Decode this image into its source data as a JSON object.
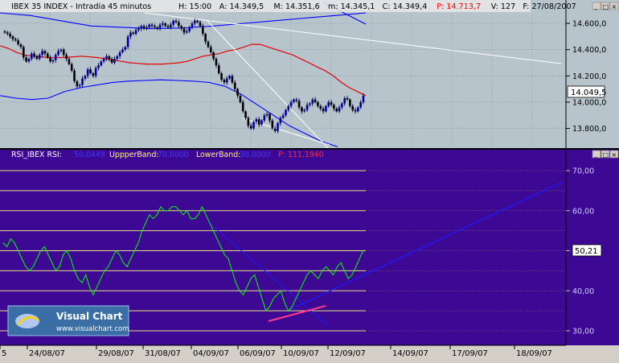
{
  "price_panel": {
    "title": "IBEX 35 INDEX - Intradia 45 minutos",
    "fields": [
      {
        "label": "H:",
        "value": "15:00",
        "color": "#000000"
      },
      {
        "label": "A:",
        "value": "14.349,5",
        "color": "#000000"
      },
      {
        "label": "M:",
        "value": "14.351,6",
        "color": "#000000"
      },
      {
        "label": "m:",
        "value": "14.345,1",
        "color": "#000000"
      },
      {
        "label": "C:",
        "value": "14.349,4",
        "color": "#000000"
      },
      {
        "label": "P:",
        "value": "14.713,7",
        "color": "#ff0000"
      },
      {
        "label": "V:",
        "value": "127",
        "color": "#000000"
      },
      {
        "label": "F:",
        "value": "27/08/2007",
        "color": "#000000"
      }
    ],
    "last_value_label": "14.049,5",
    "colors": {
      "background": "#b8c4cc",
      "candles": "#000080",
      "bollinger_band": "#0000ff",
      "moving_average": "#ff0000",
      "trendline": "#ffffff"
    }
  },
  "rsi_panel": {
    "title": "RSI_IBEX RSI:",
    "rsi_value": "50,0449",
    "upper_label": "UppperBand:",
    "upper_value": "70,0000",
    "lower_label": "LowerBand:",
    "lower_value": "30,0000",
    "p_label": "P:",
    "p_value": "111,1940",
    "last_value_label": "50,21",
    "colors": {
      "background": "#3c0894",
      "rsi_line": "#00ff00",
      "level_lines": "#e8e080",
      "trendline": "#1c1cff",
      "support_line": "#ff3c8c"
    }
  },
  "watermark": {
    "brand": "Visual Chart",
    "url": "www.visualchart.com"
  },
  "window_buttons": [
    "_",
    "□",
    "×"
  ],
  "chart_data": [
    {
      "type": "candlestick",
      "title": "IBEX 35 INDEX - Intradia 45 minutos",
      "y_ticks": [
        "13.800,0",
        "14.000,0",
        "14.200,0",
        "14.400,0",
        "14.600,0"
      ],
      "ylim": [
        13650,
        14680
      ],
      "close": [
        14530,
        14520,
        14500,
        14480,
        14470,
        14440,
        14420,
        14340,
        14310,
        14330,
        14370,
        14350,
        14330,
        14360,
        14390,
        14370,
        14340,
        14310,
        14320,
        14360,
        14390,
        14400,
        14360,
        14330,
        14290,
        14240,
        14160,
        14120,
        14130,
        14180,
        14200,
        14250,
        14220,
        14200,
        14260,
        14280,
        14310,
        14330,
        14350,
        14330,
        14300,
        14330,
        14350,
        14380,
        14400,
        14420,
        14500,
        14530,
        14520,
        14550,
        14560,
        14580,
        14560,
        14570,
        14590,
        14580,
        14570,
        14560,
        14590,
        14600,
        14580,
        14570,
        14590,
        14620,
        14610,
        14580,
        14560,
        14530,
        14540,
        14570,
        14600,
        14620,
        14610,
        14580,
        14520,
        14460,
        14420,
        14380,
        14330,
        14280,
        14220,
        14170,
        14150,
        14180,
        14200,
        14150,
        14100,
        14050,
        14000,
        13930,
        13880,
        13820,
        13800,
        13850,
        13870,
        13830,
        13860,
        13900,
        13910,
        13860,
        13800,
        13780,
        13840,
        13880,
        13900,
        13940,
        13970,
        14000,
        14020,
        14010,
        13960,
        13930,
        13940,
        13980,
        13990,
        14020,
        14000,
        13970,
        13950,
        13930,
        13970,
        14000,
        13980,
        13950,
        13930,
        13960,
        13990,
        14030,
        14020,
        13970,
        13940,
        13930,
        13960,
        14000,
        14049.5
      ],
      "series": [
        {
          "name": "Moving average (red)",
          "values": [
            14430,
            14410,
            14380,
            14360,
            14350,
            14345,
            14340,
            14340,
            14340,
            14345,
            14350,
            14345,
            14340,
            14330,
            14320,
            14310,
            14300,
            14295,
            14290,
            14290,
            14290,
            14295,
            14300,
            14310,
            14330,
            14350,
            14360,
            14370,
            14390,
            14400,
            14420,
            14440,
            14440,
            14420,
            14400,
            14380,
            14360,
            14330,
            14300,
            14270,
            14240,
            14200,
            14150,
            14110,
            14080,
            14049.5
          ]
        },
        {
          "name": "Upper band (blue)",
          "values": [
            14680,
            14660,
            14620,
            14580,
            14570,
            14560,
            14565,
            14580,
            14600,
            14620,
            14640,
            14660,
            14680
          ]
        },
        {
          "name": "Lower band (blue)",
          "values": [
            14050,
            14030,
            14020,
            14030,
            14080,
            14110,
            14130,
            14150,
            14160,
            14165,
            14170,
            14165,
            14160,
            14150,
            14120,
            14060,
            13980,
            13900,
            13820,
            13760,
            13700,
            13660
          ]
        }
      ]
    },
    {
      "type": "line",
      "title": "RSI_IBEX RSI:",
      "y_ticks": [
        "30,00",
        "40,00",
        "50,00",
        "60,00",
        "70,00"
      ],
      "ylim": [
        25,
        75
      ],
      "levels": [
        30,
        35,
        40,
        45,
        50,
        55,
        60,
        65,
        70
      ],
      "x_labels": [
        "5",
        "24/08/07",
        "29/08/07",
        "31/08/07",
        "04/09/07",
        "06/09/07",
        "10/09/07",
        "12/09/07",
        "14/09/07",
        "17/09/07",
        "18/09/07"
      ],
      "series": [
        {
          "name": "RSI",
          "values": [
            52,
            51,
            53,
            52,
            50,
            48,
            46,
            45,
            46,
            48,
            50,
            51,
            49,
            47,
            45,
            46,
            49,
            50,
            48,
            45,
            43,
            42,
            44,
            41,
            39,
            41,
            43,
            45,
            46,
            48,
            50,
            49,
            47,
            46,
            48,
            50,
            52,
            55,
            57,
            59,
            58,
            59,
            61,
            60,
            60,
            61,
            61,
            60,
            59,
            60,
            58,
            58,
            59,
            61,
            59,
            57,
            55,
            53,
            51,
            49,
            48,
            45,
            42,
            40,
            39,
            41,
            43,
            44,
            41,
            38,
            35,
            36,
            38,
            39,
            40,
            37,
            35,
            36,
            38,
            40,
            42,
            44,
            45,
            44,
            43,
            45,
            46,
            45,
            44,
            46,
            47,
            45,
            43,
            44,
            46,
            48,
            50.21
          ]
        }
      ]
    }
  ]
}
